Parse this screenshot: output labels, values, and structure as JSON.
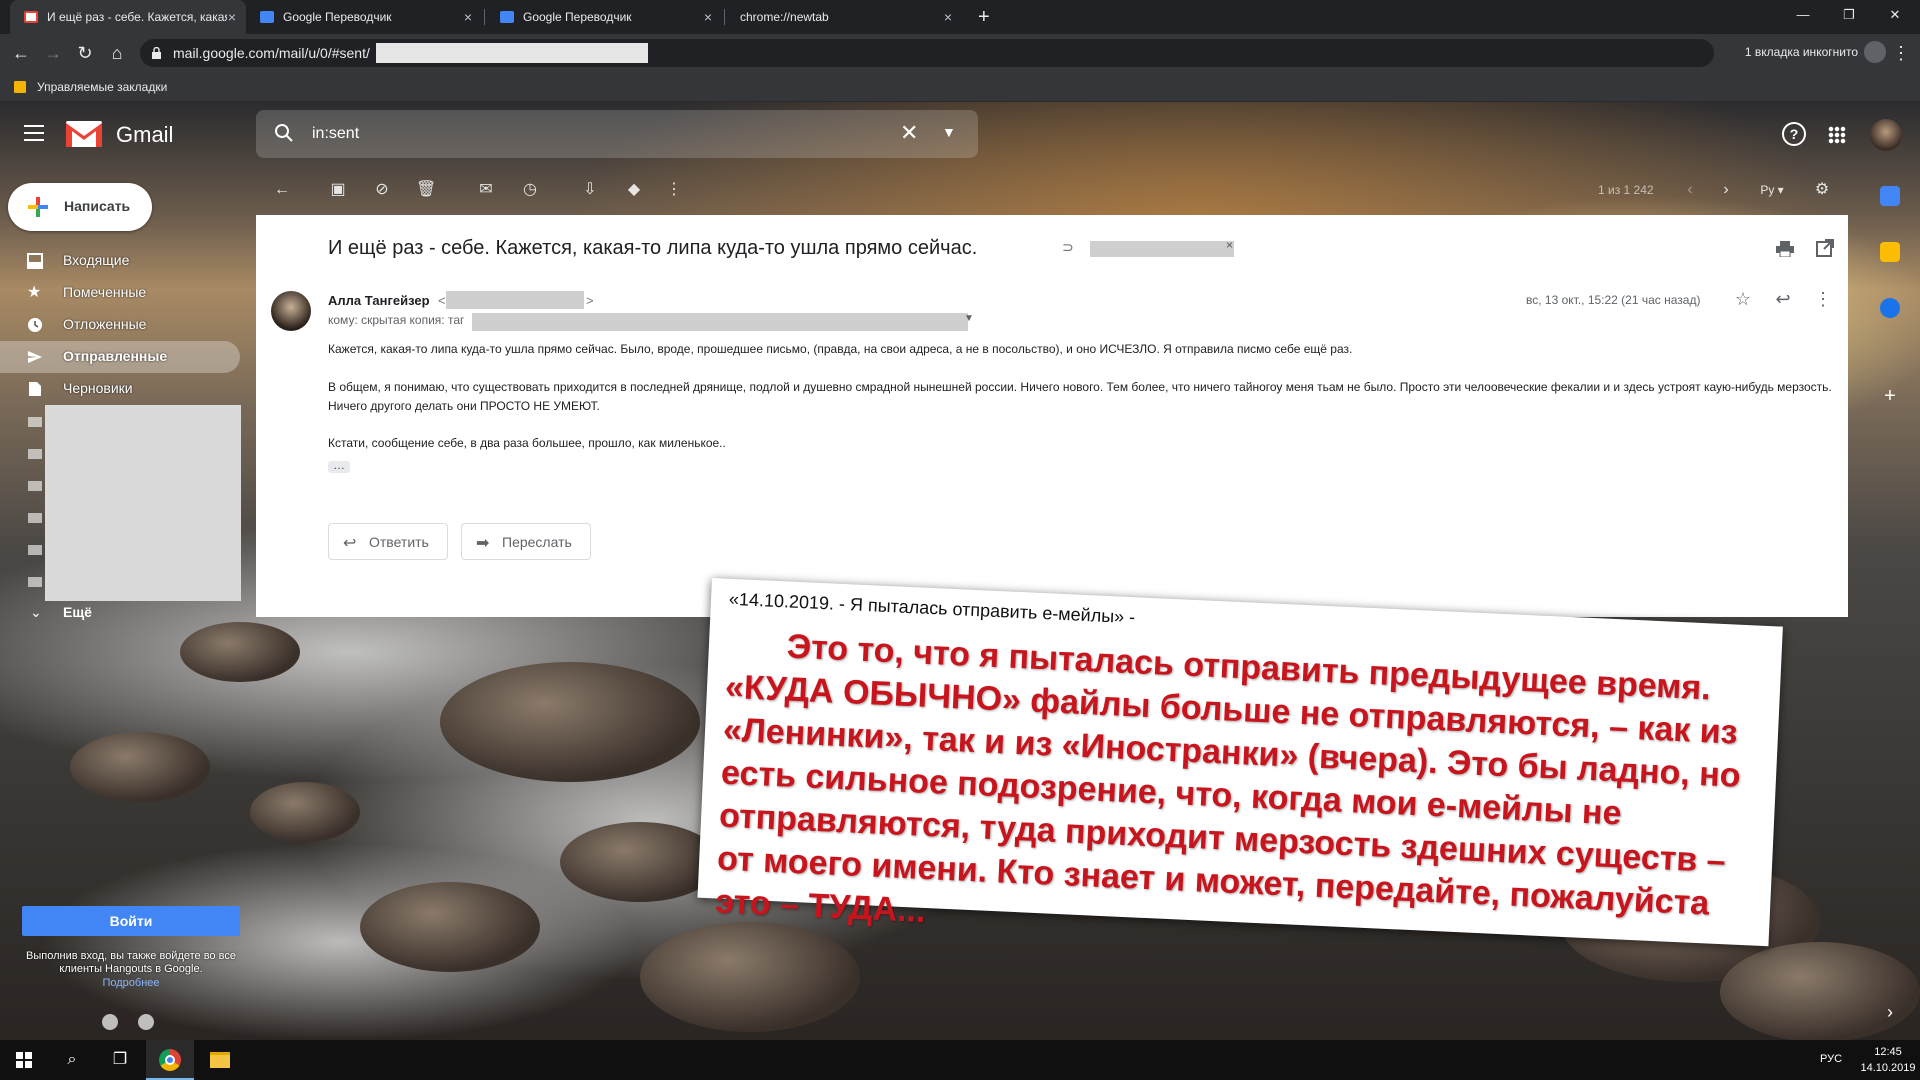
{
  "tabs": [
    {
      "title": "И ещё раз - себе. Кажется, какая"
    },
    {
      "title": "Google Переводчик"
    },
    {
      "title": "Google Переводчик"
    },
    {
      "title": "chrome://newtab"
    }
  ],
  "address": {
    "url": "mail.google.com/mail/u/0/#sent/",
    "incognito_label": "1 вкладка инкогнито"
  },
  "bookmarks_bar": {
    "folder_label": "Управляемые закладки"
  },
  "gmail": {
    "brand": "Gmail",
    "search_query": "in:sent",
    "compose_label": "Написать",
    "nav": [
      {
        "label": "Входящие"
      },
      {
        "label": "Помеченные"
      },
      {
        "label": "Отложенные"
      },
      {
        "label": "Отправленные"
      },
      {
        "label": "Черновики"
      }
    ],
    "more_label": "Ещё",
    "pager": "1 из 1 242",
    "lang_label": "Ру",
    "hangouts": {
      "signin": "Войти",
      "text": "Выполнив вход, вы также войдете во все клиенты Hangouts в Google.",
      "link": "Подробнее"
    }
  },
  "message": {
    "subject": "И ещё раз - себе. Кажется, какая-то липа куда-то ушла прямо сейчас.",
    "sender_name": "Алла Тангейзер",
    "to_line": "кому: скрытая копия: таг",
    "date": "вс, 13 окт., 15:22 (21 час назад)",
    "paragraphs": [
      "Кажется, какая-то липа куда-то ушла прямо сейчас. Было, вроде, прошедшее письмо, (правда, на свои адреса, а не в посольство), и оно ИСЧЕЗЛО. Я отправила писмо себе ещё раз.",
      "В общем, я понимаю, что существовать приходится в последней дрянище, подлой и душевно смрадной нынешней россии. Ничего нового. Тем более, что ничего  тайногоу  меня тьам не было. Просто эти челоовеческие фекалии и и здесь устроят каую-нибудь мерзость. Ничего другого делать они ПРОСТО НЕ УМЕЮТ.",
      "Кстати, сообщение себе, в два раза большее, прошло, как миленькое.."
    ],
    "reply_label": "Ответить",
    "forward_label": "Переслать"
  },
  "note": {
    "header": "«14.10.2019. - Я пыталась отправить е-мейлы» -",
    "body_parts": [
      "Это то, что я пыталась отправить предыдущее время. «",
      "КУДА ОБЫЧНО",
      "» файлы больше не отправляются, – как из «Ленинки», так и из «Иностранки» (вчера). Это бы ладно, но есть сильное подозрение, что, когда мои е-мейлы не отправляются, туда приходит мерзость здешних существ – от моего имени. Кто знает и может, передайте, пожалуйста это – ",
      "ТУДА",
      "..."
    ]
  },
  "taskbar": {
    "lang": "РУС",
    "time": "12:45",
    "date": "14.10.2019"
  },
  "colors": {
    "chrome_dark": "#202124",
    "gmail_red": "#ea4335",
    "note_red": "#c8141c",
    "signin_blue": "#4285f4"
  }
}
